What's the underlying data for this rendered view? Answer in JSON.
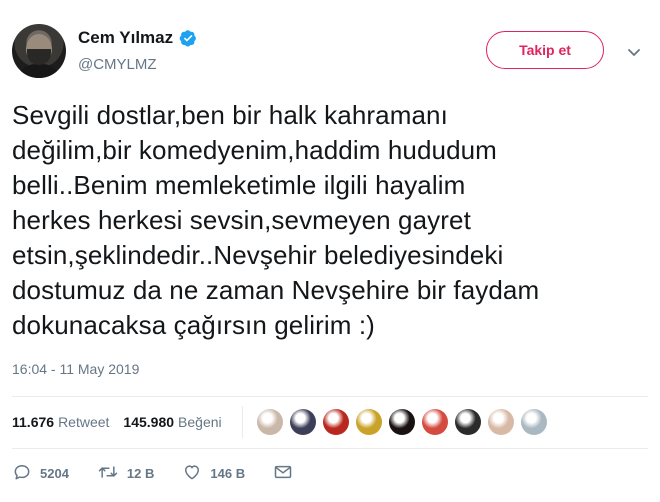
{
  "author": {
    "display_name": "Cem Yılmaz",
    "handle": "@CMYLMZ",
    "verified": true
  },
  "follow_button_label": "Takip et",
  "tweet": {
    "lines": [
      "Sevgili dostlar,ben bir halk kahramanı",
      "değilim,bir komedyenim,haddim hududum",
      "belli..Benim memleketimle ilgili hayalim",
      "herkes herkesi sevsin,sevmeyen gayret",
      "etsin,şeklindedir..Nevşehir belediyesindeki",
      "dostumuz da ne zaman Nevşehire bir faydam",
      "dokunacaksa çağırsın gelirim :)"
    ],
    "timestamp": "16:04 - 11 May 2019"
  },
  "stats": {
    "retweets_count": "11.676",
    "retweets_label": "Retweet",
    "likes_count": "145.980",
    "likes_label": "Beğeni"
  },
  "likers": [
    {
      "name": "liker-1",
      "color": "#c9b7a8"
    },
    {
      "name": "liker-2",
      "color": "#3d3f58"
    },
    {
      "name": "liker-3",
      "color": "#b8281f"
    },
    {
      "name": "liker-4",
      "color": "#c9a22a"
    },
    {
      "name": "liker-5",
      "color": "#1a1212"
    },
    {
      "name": "liker-6",
      "color": "#d44b3f"
    },
    {
      "name": "liker-7",
      "color": "#2b2b2b"
    },
    {
      "name": "liker-8",
      "color": "#d8b9a6"
    },
    {
      "name": "liker-9",
      "color": "#aab8c2"
    }
  ],
  "actions": {
    "reply_count": "5204",
    "retweet_count": "12 B",
    "like_count": "146 B"
  },
  "colors": {
    "accent": "#e0245e",
    "verified": "#1da1f2",
    "muted": "#657786",
    "text": "#14171a"
  }
}
